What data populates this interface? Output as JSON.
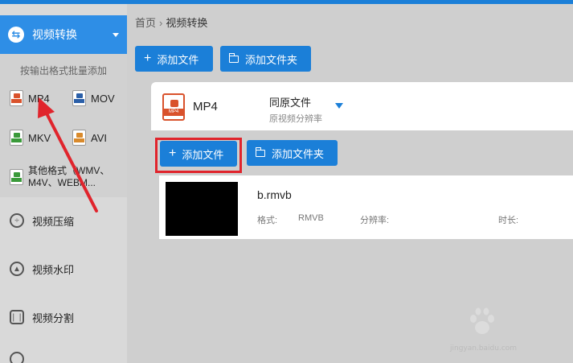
{
  "breadcrumb": {
    "home": "首页",
    "separator": "›",
    "current": "视频转换"
  },
  "sidebar": {
    "active": {
      "label": "视频转换",
      "icon": "convert-icon"
    },
    "hint": "按输出格式批量添加",
    "formats": [
      {
        "label": "MP4",
        "color": "#d9522c"
      },
      {
        "label": "MOV",
        "color": "#2b5fa8"
      },
      {
        "label": "MKV",
        "color": "#3a9a3a"
      },
      {
        "label": "AVI",
        "color": "#d98a2c"
      }
    ],
    "other_formats": {
      "line1": "其他格式（WMV、",
      "line2": "M4V、WEBM..."
    },
    "items": [
      {
        "label": "视频压缩",
        "icon": "compress-icon"
      },
      {
        "label": "视频水印",
        "icon": "watermark-icon"
      },
      {
        "label": "视频分割",
        "icon": "split-icon"
      }
    ]
  },
  "toolbar": {
    "add_file": "添加文件",
    "add_folder": "添加文件夹"
  },
  "output": {
    "format": "MP4",
    "format_badge": "MP4",
    "resolution": "同原文件",
    "resolution_sub": "原视频分辨率"
  },
  "inner_toolbar": {
    "add_file": "添加文件",
    "add_folder": "添加文件夹"
  },
  "file": {
    "name": "b.rmvb",
    "format_label": "格式:",
    "format_value": "RMVB",
    "resolution_label": "分辨率:",
    "duration_label": "时长:"
  },
  "watermark": {
    "logo_text": "Bai经验",
    "url": "jingyan.baidu.com"
  },
  "colors": {
    "accent": "#1b7fd8",
    "highlight": "#e0242c",
    "arrow": "#e0242c"
  }
}
